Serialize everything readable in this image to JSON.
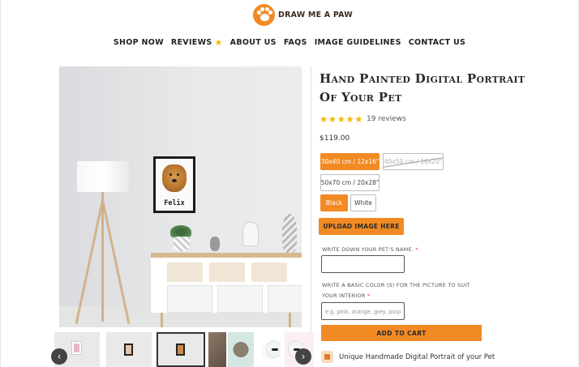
{
  "brand": {
    "name": "DRAW ME A PAW",
    "accent_color": "#f28a24"
  },
  "nav": {
    "items": [
      {
        "label": "SHOP NOW"
      },
      {
        "label": "REVIEWS",
        "icon": "star-icon"
      },
      {
        "label": "ABOUT US"
      },
      {
        "label": "FAQS"
      },
      {
        "label": "IMAGE GUIDELINES"
      },
      {
        "label": "CONTACT US"
      }
    ]
  },
  "gallery": {
    "main_image": {
      "pet_name": "Felix"
    },
    "prev_icon": "chevron-left-icon",
    "next_icon": "chevron-right-icon"
  },
  "product": {
    "title": "Hand Painted Digital Portrait Of Your Pet",
    "rating": {
      "stars": 5,
      "reviews_text": "19 reviews"
    },
    "price": "$119.00",
    "sizes": [
      {
        "label": "30x40 cm / 12x16\"",
        "selected": true,
        "available": true
      },
      {
        "label": "40x50 cm / 16x20\"",
        "selected": false,
        "available": false
      },
      {
        "label": "50x70 cm / 20x28\"",
        "selected": false,
        "available": true
      }
    ],
    "frame_colors": [
      {
        "label": "Black",
        "selected": true
      },
      {
        "label": "White",
        "selected": false
      }
    ],
    "upload_label": "UPLOAD IMAGE HERE",
    "pet_name_field": {
      "label": "WRITE DOWN YOUR PET'S NAME.",
      "value": "",
      "placeholder": ""
    },
    "color_field": {
      "label": "WRITE A BASIC COLOR (S) FOR THE PICTURE TO SUIT YOUR INTERIOR",
      "value": "",
      "placeholder": "e.g. pink, orange, grey, purple"
    },
    "required_marker": "*",
    "add_to_cart_label": "ADD TO CART",
    "feature_text": "Unique Handmade Digital Portrait of your Pet"
  }
}
